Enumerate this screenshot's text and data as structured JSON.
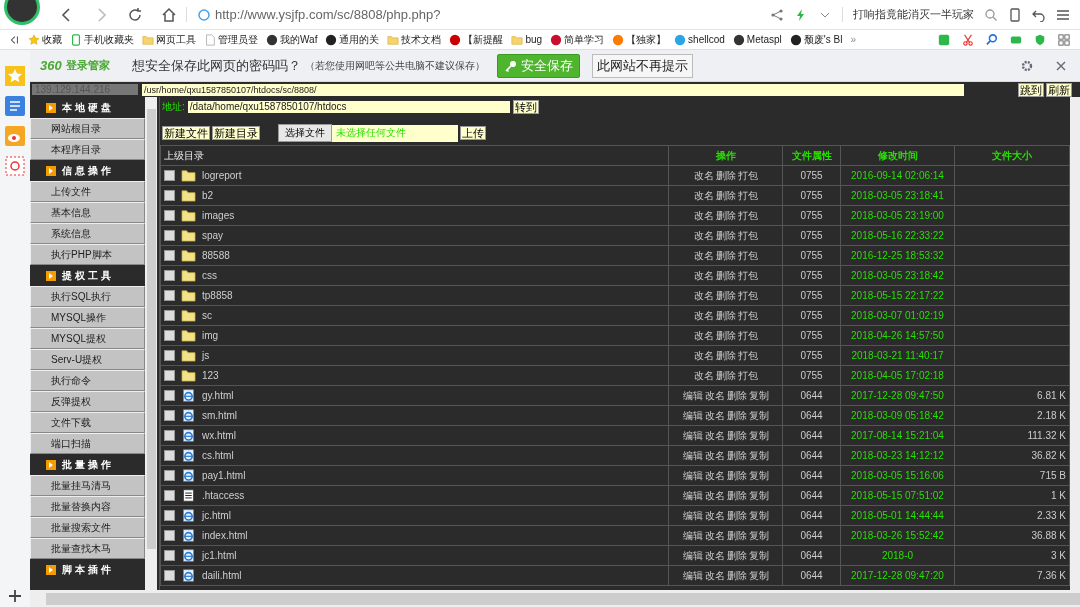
{
  "browser": {
    "url_host": "http://www.ysjfp.com",
    "url_path": "/sc/8808/php.php?",
    "search_text": "打响指竟能消灭一半玩家"
  },
  "bookmarks": [
    {
      "label": "收藏",
      "kind": "star"
    },
    {
      "label": "手机收藏夹",
      "kind": "phone"
    },
    {
      "label": "网页工具",
      "kind": "folder"
    },
    {
      "label": "管理员登",
      "kind": "page"
    },
    {
      "label": "我的Waf",
      "kind": "site"
    },
    {
      "label": "通用的关",
      "kind": "site"
    },
    {
      "label": "技术文档",
      "kind": "folder"
    },
    {
      "label": "【新提醒",
      "kind": "site"
    },
    {
      "label": "bug",
      "kind": "folder"
    },
    {
      "label": "简单学习",
      "kind": "site"
    },
    {
      "label": "【独家】",
      "kind": "site"
    },
    {
      "label": "shellcod",
      "kind": "site"
    },
    {
      "label": "Metaspl",
      "kind": "site"
    },
    {
      "label": "颓废's Bl",
      "kind": "site"
    }
  ],
  "bookmarks_more": "»",
  "password_bar": {
    "logo_number": "360",
    "logo_text": "登录管家",
    "question": "想安全保存此网页的密码吗？",
    "note": "（若您使用网吧等公共电脑不建议保存）",
    "save_button": "安全保存",
    "never_button": "此网站不再提示"
  },
  "shell": {
    "ip": "139.129.144.216",
    "path": "/usr/home/qxu1587850107/htdocs/sc/8808/",
    "jump_button": "跳到",
    "refresh_button": "刷新",
    "address_label": "地址:",
    "address": "/data/home/qxu1587850107/htdocs",
    "goto_button": "转到",
    "new_file_button": "新建文件",
    "new_dir_button": "新建目录",
    "choose_file_button": "选择文件",
    "no_file_text": "未选择任何文件",
    "upload_button": "上传"
  },
  "menu": [
    {
      "label": "本地硬盘",
      "kind": "header"
    },
    {
      "label": "网站根目录",
      "kind": "item"
    },
    {
      "label": "本程序目录",
      "kind": "item"
    },
    {
      "label": "信息操作",
      "kind": "header"
    },
    {
      "label": "上传文件",
      "kind": "item"
    },
    {
      "label": "基本信息",
      "kind": "item"
    },
    {
      "label": "系统信息",
      "kind": "item"
    },
    {
      "label": "执行PHP脚本",
      "kind": "item"
    },
    {
      "label": "提权工具",
      "kind": "header"
    },
    {
      "label": "执行SQL执行",
      "kind": "item"
    },
    {
      "label": "MYSQL操作",
      "kind": "item"
    },
    {
      "label": "MYSQL提权",
      "kind": "item"
    },
    {
      "label": "Serv-U提权",
      "kind": "item"
    },
    {
      "label": "执行命令",
      "kind": "item"
    },
    {
      "label": "反弹提权",
      "kind": "item"
    },
    {
      "label": "文件下载",
      "kind": "item"
    },
    {
      "label": "端口扫描",
      "kind": "item"
    },
    {
      "label": "批量操作",
      "kind": "header"
    },
    {
      "label": "批量挂马清马",
      "kind": "item"
    },
    {
      "label": "批量替换内容",
      "kind": "item"
    },
    {
      "label": "批量搜索文件",
      "kind": "item"
    },
    {
      "label": "批量查找木马",
      "kind": "item"
    },
    {
      "label": "脚本插件",
      "kind": "header"
    }
  ],
  "table": {
    "columns": [
      "上级目录",
      "操作",
      "文件属性",
      "修改时间",
      "文件大小"
    ],
    "rows": [
      {
        "name": "logreport",
        "kind": "folder",
        "checked": false,
        "actions": [
          "改名",
          "删除",
          "打包"
        ],
        "mode": "0755",
        "modified": "2016-09-14 02:06:14"
      },
      {
        "name": "b2",
        "kind": "folder",
        "checked": false,
        "actions": [
          "改名",
          "删除",
          "打包"
        ],
        "mode": "0755",
        "modified": "2018-03-05 23:18:41"
      },
      {
        "name": "images",
        "kind": "folder",
        "checked": false,
        "actions": [
          "改名",
          "删除",
          "打包"
        ],
        "mode": "0755",
        "modified": "2018-03-05 23:19:00"
      },
      {
        "name": "spay",
        "kind": "folder",
        "checked": false,
        "actions": [
          "改名",
          "删除",
          "打包"
        ],
        "mode": "0755",
        "modified": "2018-05-16 22:33:22"
      },
      {
        "name": "88588",
        "kind": "folder",
        "checked": false,
        "actions": [
          "改名",
          "删除",
          "打包"
        ],
        "mode": "0755",
        "modified": "2016-12-25 18:53:32"
      },
      {
        "name": "css",
        "kind": "folder",
        "checked": false,
        "actions": [
          "改名",
          "删除",
          "打包"
        ],
        "mode": "0755",
        "modified": "2018-03-05 23:18:42"
      },
      {
        "name": "tp8858",
        "kind": "folder",
        "checked": false,
        "actions": [
          "改名",
          "删除",
          "打包"
        ],
        "mode": "0755",
        "modified": "2018-05-15 22:17:22"
      },
      {
        "name": "sc",
        "kind": "folder",
        "checked": false,
        "actions": [
          "改名",
          "删除",
          "打包"
        ],
        "mode": "0755",
        "modified": "2018-03-07 01:02:19"
      },
      {
        "name": "img",
        "kind": "folder",
        "checked": false,
        "actions": [
          "改名",
          "删除",
          "打包"
        ],
        "mode": "0755",
        "modified": "2018-04-26 14:57:50"
      },
      {
        "name": "js",
        "kind": "folder",
        "checked": false,
        "actions": [
          "改名",
          "删除",
          "打包"
        ],
        "mode": "0755",
        "modified": "2018-03-21 11:40:17"
      },
      {
        "name": "123",
        "kind": "folder",
        "checked": false,
        "actions": [
          "改名",
          "删除",
          "打包"
        ],
        "mode": "0755",
        "modified": "2018-04-05 17:02:18"
      },
      {
        "name": "gy.html",
        "kind": "html",
        "checked": false,
        "actions": [
          "编辑",
          "改名",
          "删除",
          "复制"
        ],
        "mode": "0644",
        "modified": "2017-12-28 09:47:50",
        "size": "6.81 K"
      },
      {
        "name": "sm.html",
        "kind": "html",
        "checked": false,
        "actions": [
          "编辑",
          "改名",
          "删除",
          "复制"
        ],
        "mode": "0644",
        "modified": "2018-03-09 05:18:42",
        "size": "2.18 K"
      },
      {
        "name": "wx.html",
        "kind": "html",
        "checked": false,
        "actions": [
          "编辑",
          "改名",
          "删除",
          "复制"
        ],
        "mode": "0644",
        "modified": "2017-08-14 15:21:04",
        "size": "111.32 K"
      },
      {
        "name": "cs.html",
        "kind": "html",
        "checked": false,
        "actions": [
          "编辑",
          "改名",
          "删除",
          "复制"
        ],
        "mode": "0644",
        "modified": "2018-03-23 14:12:12",
        "size": "36.82 K"
      },
      {
        "name": "pay1.html",
        "kind": "html",
        "checked": false,
        "actions": [
          "编辑",
          "改名",
          "删除",
          "复制"
        ],
        "mode": "0644",
        "modified": "2018-03-05 15:16:06",
        "size": "715 B"
      },
      {
        "name": ".htaccess",
        "kind": "text",
        "checked": false,
        "actions": [
          "编辑",
          "改名",
          "删除",
          "复制"
        ],
        "mode": "0644",
        "modified": "2018-05-15 07:51:02",
        "size": "1 K"
      },
      {
        "name": "jc.html",
        "kind": "html",
        "checked": false,
        "actions": [
          "编辑",
          "改名",
          "删除",
          "复制"
        ],
        "mode": "0644",
        "modified": "2018-05-01 14:44:44",
        "size": "2.33 K"
      },
      {
        "name": "index.html",
        "kind": "html",
        "checked": false,
        "actions": [
          "编辑",
          "改名",
          "删除",
          "复制"
        ],
        "mode": "0644",
        "modified": "2018-03-26 15:52:42",
        "size": "36.88 K"
      },
      {
        "name": "jc1.html",
        "kind": "html",
        "checked": false,
        "actions": [
          "编辑",
          "改名",
          "删除",
          "复制"
        ],
        "mode": "0644",
        "modified": "2018-0",
        "size": "3 K"
      },
      {
        "name": "daili.html",
        "kind": "html",
        "checked": false,
        "actions": [
          "编辑",
          "改名",
          "删除",
          "复制"
        ],
        "mode": "0644",
        "modified": "2017-12-28 09:47:20",
        "size": "7.36 K"
      }
    ]
  }
}
